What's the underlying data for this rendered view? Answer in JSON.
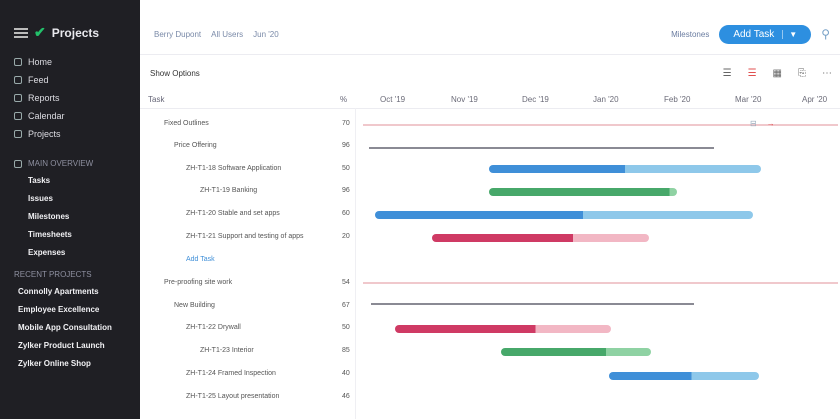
{
  "app": {
    "title": "Projects"
  },
  "sidebar": {
    "nav": [
      {
        "label": "Home"
      },
      {
        "label": "Feed"
      },
      {
        "label": "Reports"
      },
      {
        "label": "Calendar"
      },
      {
        "label": "Projects"
      }
    ],
    "overview_title": "MAIN OVERVIEW",
    "overview_items": [
      {
        "label": "Tasks"
      },
      {
        "label": "Issues"
      },
      {
        "label": "Milestones"
      },
      {
        "label": "Timesheets"
      },
      {
        "label": "Expenses"
      }
    ],
    "recent_title": "RECENT PROJECTS",
    "recent_items": [
      {
        "label": "Connolly Apartments"
      },
      {
        "label": "Employee Excellence"
      },
      {
        "label": "Mobile App Consultation"
      },
      {
        "label": "Zylker Product Launch"
      },
      {
        "label": "Zylker Online Shop"
      }
    ]
  },
  "header": {
    "crumbs": [
      "Berry Dupont",
      "All Users",
      "Jun '20"
    ],
    "milestone_label": "Milestones",
    "add_task_label": "Add Task"
  },
  "toolbar": {
    "show_options_label": "Show Options"
  },
  "columns": {
    "task": "Task",
    "pct": "%"
  },
  "months": [
    "Oct '19",
    "Nov '19",
    "Dec '19",
    "Jan '20",
    "Feb '20",
    "Mar '20",
    "Apr '20"
  ],
  "rows": [
    {
      "label": "Fixed Outlines",
      "pct": "70",
      "indent": 1
    },
    {
      "label": "Price Offering",
      "pct": "96",
      "indent": 2
    },
    {
      "label": "ZH-T1-18 Software Application",
      "pct": "50",
      "indent": 3
    },
    {
      "label": "ZH-T1-19 Banking",
      "pct": "96",
      "indent": 4
    },
    {
      "label": "ZH-T1-20 Stable and set apps",
      "pct": "60",
      "indent": 3
    },
    {
      "label": "ZH-T1-21 Support and testing of apps",
      "pct": "20",
      "indent": 3
    },
    {
      "label": "Add Task",
      "pct": "",
      "indent": 3,
      "link": true
    },
    {
      "label": "Pre-proofing site work",
      "pct": "54",
      "indent": 1
    },
    {
      "label": "New Building",
      "pct": "67",
      "indent": 2
    },
    {
      "label": "ZH-T1-22 Drywall",
      "pct": "50",
      "indent": 3
    },
    {
      "label": "ZH-T1-23 Interior",
      "pct": "85",
      "indent": 4
    },
    {
      "label": "ZH-T1-24 Framed Inspection",
      "pct": "40",
      "indent": 3
    },
    {
      "label": "ZH-T1-25 Layout presentation",
      "pct": "46",
      "indent": 3
    }
  ],
  "colors": {
    "blue": "#3f8fd8",
    "blue_light": "#8ec8ea",
    "green": "#47a86a",
    "green_light": "#8fd2a3",
    "red": "#cf3a64",
    "red_light": "#f2b7c4",
    "gray_line": "#8a8a94",
    "pink_line": "#f0c8cc"
  }
}
